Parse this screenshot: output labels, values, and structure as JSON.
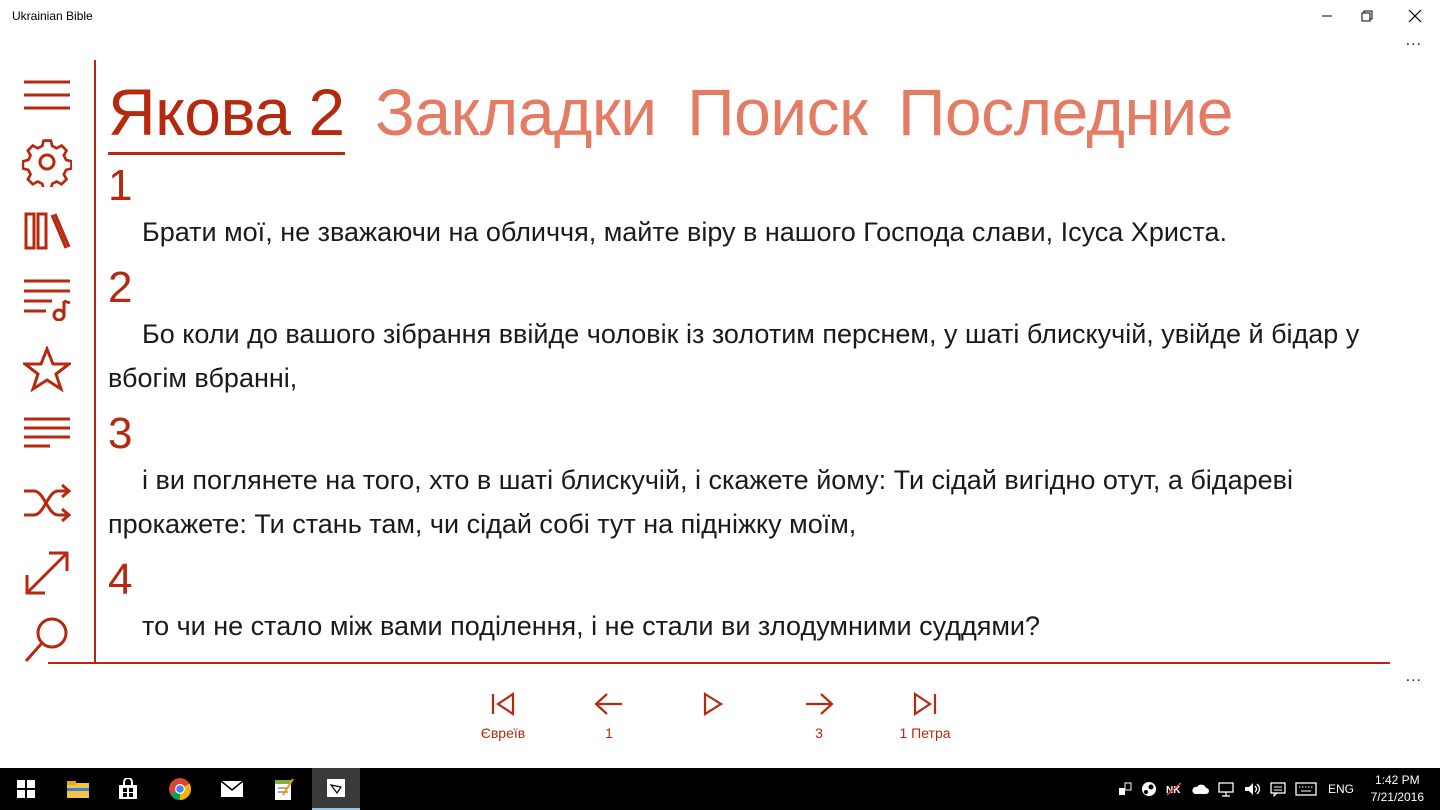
{
  "window": {
    "title": "Ukrainian Bible",
    "more_label": "..."
  },
  "pivot": {
    "items": [
      {
        "label": "Якова 2",
        "active": true
      },
      {
        "label": "Закладки",
        "active": false
      },
      {
        "label": "Поиск",
        "active": false
      },
      {
        "label": "Последние",
        "active": false
      }
    ]
  },
  "rail": {
    "items": [
      "menu-icon",
      "gear-icon",
      "library-icon",
      "playlist-icon",
      "star-icon",
      "text-lines-icon",
      "shuffle-icon",
      "fullscreen-icon",
      "search-icon"
    ]
  },
  "verses": [
    {
      "num": "1",
      "text": "Брати мої, не зважаючи на обличчя, майте віру в нашого Господа слави, Ісуса Христа."
    },
    {
      "num": "2",
      "text": "Бо коли до вашого зібрання ввійде чоловік із золотим перснем, у шаті блискучій, увійде й бідар у вбогім вбранні,"
    },
    {
      "num": "3",
      "text": "і ви поглянете на того, хто в шаті блискучій, і скажете йому: Ти сідай вигідно отут, а бідареві прокажете: Ти стань там, чи сідай собі тут на підніжку моїм,"
    },
    {
      "num": "4",
      "text": "то чи не стало між вами поділення, і не стали ви злодумними суддями?"
    }
  ],
  "nav": {
    "first_label": "Євреїв",
    "prev_label": "1",
    "play_label": "",
    "next_label": "3",
    "last_label": "1 Петра"
  },
  "taskbar": {
    "language": "ENG",
    "time": "1:42 PM",
    "date": "7/21/2016"
  },
  "colors": {
    "accent": "#b5290f",
    "accent_light": "#e47b63",
    "taskbar": "#000000"
  }
}
